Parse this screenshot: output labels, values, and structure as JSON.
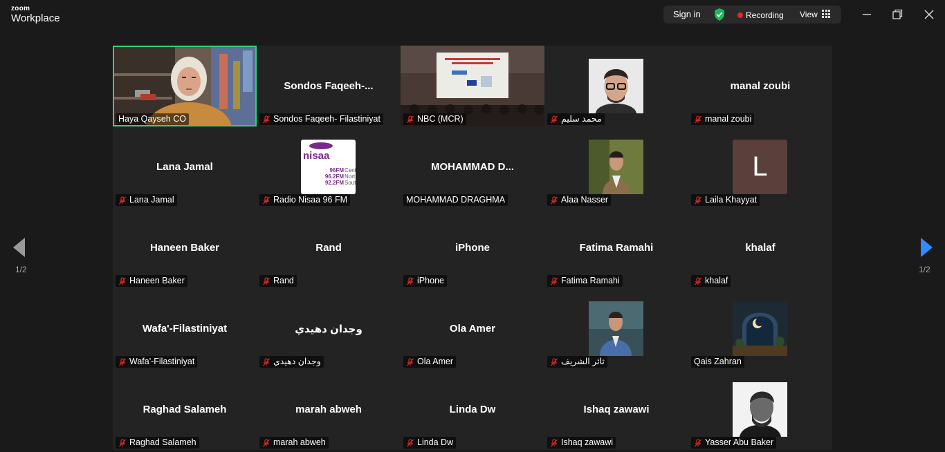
{
  "app": {
    "logo_top": "zoom",
    "logo_bottom": "Workplace"
  },
  "toolbar": {
    "sign_in": "Sign in",
    "recording": "Recording",
    "view": "View"
  },
  "nav": {
    "prev_page": "1/2",
    "next_page": "1/2"
  },
  "participants": [
    {
      "name": "",
      "label": "Haya Qayseh CO",
      "muted": false,
      "media": "video-haya",
      "active": true
    },
    {
      "name": "Sondos  Faqeeh-...",
      "label": "Sondos Faqeeh- Filastiniyat",
      "muted": true
    },
    {
      "name": "",
      "label": "NBC (MCR)",
      "muted": true,
      "media": "video-nbc"
    },
    {
      "name": "",
      "label": "محمد سليم",
      "muted": true,
      "media": "photo-man-glasses"
    },
    {
      "name": "manal zoubi",
      "label": "manal zoubi",
      "muted": true
    },
    {
      "name": "Lana Jamal",
      "label": "Lana Jamal",
      "muted": true
    },
    {
      "name": "",
      "label": "Radio Nisaa 96 FM",
      "muted": true,
      "media": "logo-nisaa",
      "logo_text": "nisaa",
      "logo_lines": [
        "96FM",
        "96.2FM",
        "92.2FM"
      ],
      "logo_side": [
        "Cent",
        "Nort",
        "Sout"
      ]
    },
    {
      "name": "MOHAMMAD  D...",
      "label": "MOHAMMAD DRAGHMA",
      "muted": false
    },
    {
      "name": "",
      "label": "Alaa Nasser",
      "muted": true,
      "media": "photo-man-suit"
    },
    {
      "name": "",
      "label": "Laila Khayyat",
      "muted": true,
      "media": "initial",
      "initial": "L"
    },
    {
      "name": "Haneen Baker",
      "label": "Haneen Baker",
      "muted": true
    },
    {
      "name": "Rand",
      "label": "Rand",
      "muted": true
    },
    {
      "name": "iPhone",
      "label": "iPhone",
      "muted": true
    },
    {
      "name": "Fatima Ramahi",
      "label": "Fatima Ramahi",
      "muted": true
    },
    {
      "name": "khalaf",
      "label": "khalaf",
      "muted": true
    },
    {
      "name": "Wafa'-Filastiniyat",
      "label": "Wafa'-Filastiniyat",
      "muted": true
    },
    {
      "name": "وجدان دهيدي",
      "label": "وجدان دهيدي",
      "muted": true
    },
    {
      "name": "Ola Amer",
      "label": "Ola Amer",
      "muted": true
    },
    {
      "name": "",
      "label": "ثائر الشريف",
      "muted": true,
      "media": "photo-man-blue"
    },
    {
      "name": "",
      "label": "Qais Zahran",
      "muted": false,
      "media": "photo-moon"
    },
    {
      "name": "Raghad Salameh",
      "label": "Raghad Salameh",
      "muted": true
    },
    {
      "name": "marah abweh",
      "label": "marah abweh",
      "muted": true
    },
    {
      "name": "Linda Dw",
      "label": "Linda Dw",
      "muted": true
    },
    {
      "name": "Ishaq zawawi",
      "label": "Ishaq zawawi",
      "muted": true
    },
    {
      "name": "",
      "label": "Yasser Abu Baker",
      "muted": true,
      "media": "photo-bw-man"
    }
  ],
  "colors": {
    "background": "#1a1a1a",
    "tile": "#232323",
    "active_border": "#2bd475",
    "mute": "#e02828",
    "recording": "#e02828",
    "shield": "#1fb856",
    "next_arrow": "#2d8cff"
  }
}
